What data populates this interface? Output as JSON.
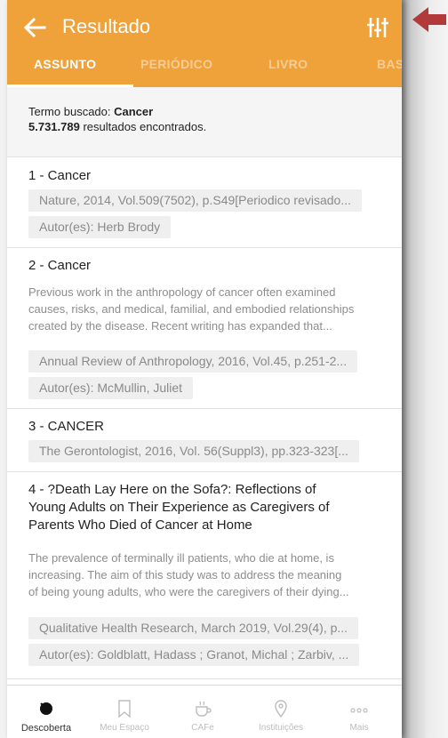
{
  "header": {
    "title": "Resultado"
  },
  "tabs": [
    {
      "label": "ASSUNTO",
      "active": true
    },
    {
      "label": "PERIÓDICO",
      "active": false
    },
    {
      "label": "LIVRO",
      "active": false
    },
    {
      "label": "BAS",
      "active": false
    }
  ],
  "summary": {
    "term_label": "Termo buscado: ",
    "term_value": "Cancer",
    "count_value": "5.731.789",
    "count_label": " resultados encontrados."
  },
  "results": [
    {
      "title": "1 - Cancer",
      "source": "Nature, 2014, Vol.509(7502), p.S49[Periodico revisado...",
      "authors": "Autor(es): Herb Brody"
    },
    {
      "title": "2 - Cancer",
      "abstract_lines": [
        "Previous work in the anthropology of cancer often examined",
        "causes, risks, and medical, familial, and embodied relationships",
        "created by the disease. Recent writing has expanded that..."
      ],
      "source": "Annual Review of Anthropology, 2016, Vol.45, p.251-2...",
      "authors": "Autor(es): McMullin, Juliet"
    },
    {
      "title": "3 - CANCER",
      "source": "The Gerontologist, 2016, Vol. 56(Suppl3), pp.323-323[..."
    },
    {
      "title_lines": [
        "4 - ?Death Lay Here on the Sofa?: Reflections of",
        "Young Adults on Their Experience as Caregivers of",
        "Parents Who Died of Cancer at Home"
      ],
      "abstract_lines": [
        "The prevalence of terminally ill patients, who die at home, is",
        "increasing. The aim of this study was to address the meaning",
        "of being young adults, who were the caregivers of their dying..."
      ],
      "source": "Qualitative Health Research, March 2019, Vol.29(4), p...",
      "authors": "Autor(es): Goldblatt, Hadass ; Granot, Michal ; Zarbiv, ..."
    }
  ],
  "bottom_nav": [
    {
      "label": "Descoberta",
      "icon": "compass-icon",
      "active": true
    },
    {
      "label": "Meu Espaço",
      "icon": "bookmark-icon",
      "active": false
    },
    {
      "label": "CAFe",
      "icon": "coffee-icon",
      "active": false
    },
    {
      "label": "Instituições",
      "icon": "location-pin-icon",
      "active": false
    },
    {
      "label": "Mais",
      "icon": "more-dots-icon",
      "active": false
    }
  ],
  "colors": {
    "appbar": "#f0a23a",
    "annotation_arrow": "#b23a3a"
  }
}
